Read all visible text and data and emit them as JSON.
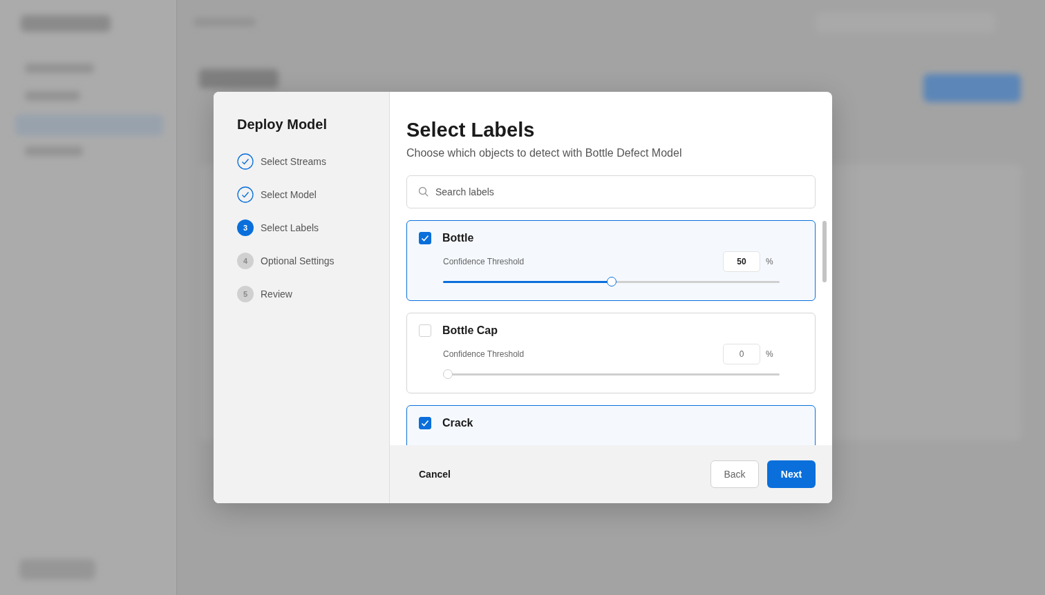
{
  "dialog": {
    "title": "Deploy Model",
    "steps": [
      {
        "label": "Select Streams",
        "kind": "done"
      },
      {
        "label": "Select Model",
        "kind": "done"
      },
      {
        "number": "3",
        "label": "Select Labels",
        "kind": "current"
      },
      {
        "number": "4",
        "label": "Optional Settings",
        "kind": "pending"
      },
      {
        "number": "5",
        "label": "Review",
        "kind": "pending"
      }
    ],
    "heading": "Select Labels",
    "subtitle": "Choose which objects to detect with Bottle Defect Model",
    "search": {
      "placeholder": "Search labels"
    },
    "labels": [
      {
        "name": "Bottle",
        "checked": true,
        "threshold_label": "Confidence Threshold",
        "value": "50",
        "unit": "%",
        "level": 0.5
      },
      {
        "name": "Bottle Cap",
        "checked": false,
        "threshold_label": "Confidence Threshold",
        "value": "0",
        "unit": "%",
        "level": 0
      },
      {
        "name": "Crack",
        "checked": true
      }
    ],
    "cancel": "Cancel",
    "back": "Back",
    "next": "Next"
  }
}
